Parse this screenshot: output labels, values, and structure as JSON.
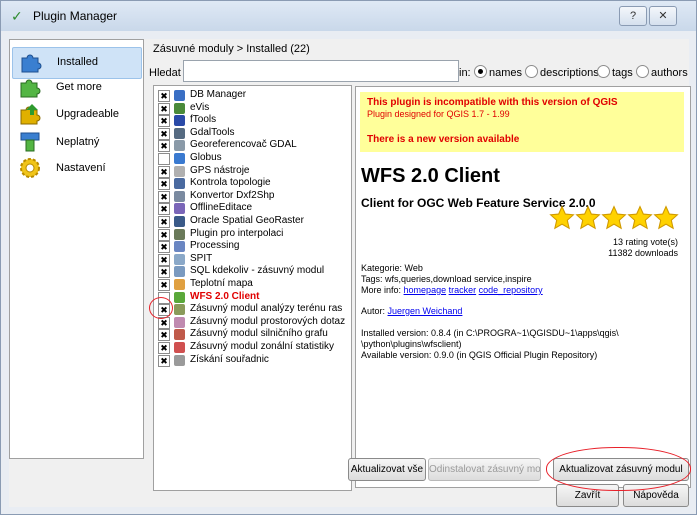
{
  "window": {
    "title": "Plugin Manager",
    "help_btn": "?",
    "close_btn": "✕"
  },
  "nav": {
    "items": [
      {
        "label": "Installed",
        "icon": "plugin-puzzle-icon",
        "selected": true
      },
      {
        "label": "Get more",
        "icon": "plugin-puzzle-icon"
      },
      {
        "label": "Upgradeable",
        "icon": "plugin-upgrade-icon"
      },
      {
        "label": "Neplatný",
        "icon": "plugin-invalid-icon"
      },
      {
        "label": "Nastavení",
        "icon": "gear-icon"
      }
    ]
  },
  "list_header": "Zásuvné moduly > Installed (22)",
  "search": {
    "label": "Hledat",
    "value": "",
    "in_label": "in:"
  },
  "filters": [
    {
      "label": "names",
      "selected": true
    },
    {
      "label": "descriptions",
      "selected": false
    },
    {
      "label": "tags",
      "selected": false
    },
    {
      "label": "authors",
      "selected": false
    }
  ],
  "plugins": [
    {
      "name": "DB Manager",
      "checked": true,
      "icon_color": "#3a6fc4"
    },
    {
      "name": "eVis",
      "checked": true,
      "icon_color": "#4a8a3a"
    },
    {
      "name": "fTools",
      "checked": true,
      "icon_color": "#2a4aa8"
    },
    {
      "name": "GdalTools",
      "checked": true,
      "icon_color": "#566b82"
    },
    {
      "name": "Georeferencovač GDAL",
      "checked": true,
      "icon_color": "#8a9aa8"
    },
    {
      "name": "Globus",
      "checked": false,
      "icon_color": "#3a7ad0"
    },
    {
      "name": "GPS nástroje",
      "checked": true,
      "icon_color": "#b0b0b0"
    },
    {
      "name": "Kontrola topologie",
      "checked": true,
      "icon_color": "#4a6aa0"
    },
    {
      "name": "Konvertor Dxf2Shp",
      "checked": true,
      "icon_color": "#7a8aa0"
    },
    {
      "name": "OfflineEditace",
      "checked": true,
      "icon_color": "#7a66b8"
    },
    {
      "name": "Oracle Spatial GeoRaster",
      "checked": true,
      "icon_color": "#3a5a88"
    },
    {
      "name": "Plugin pro interpolaci",
      "checked": true,
      "icon_color": "#6a7a5a"
    },
    {
      "name": "Processing",
      "checked": true,
      "icon_color": "#6a86c2"
    },
    {
      "name": "SPIT",
      "checked": true,
      "icon_color": "#8aa8c8"
    },
    {
      "name": "SQL kdekoliv - zásuvný modul",
      "checked": true,
      "icon_color": "#7a9ac0"
    },
    {
      "name": "Teplotní mapa",
      "checked": true,
      "icon_color": "#e0a040"
    },
    {
      "name": "WFS 2.0 Client",
      "checked": false,
      "icon_color": "#5aa83a",
      "incompatible": true
    },
    {
      "name": "Zásuvný modul analýzy terénu ras",
      "checked": true,
      "icon_color": "#8a9a5a"
    },
    {
      "name": "Zásuvný modul prostorových dotaz",
      "checked": true,
      "icon_color": "#c08ab0"
    },
    {
      "name": "Zásuvný modul silničního grafu",
      "checked": true,
      "icon_color": "#c05a4a"
    },
    {
      "name": "Zásuvný modul zonální statistiky",
      "checked": true,
      "icon_color": "#d05050"
    },
    {
      "name": "Získání souřadnic",
      "checked": true,
      "icon_color": "#9a9a9a"
    }
  ],
  "detail": {
    "warn_incompatible": "This plugin is incompatible with this version of QGIS",
    "warn_designed": "Plugin designed for QGIS 1.7 - 1.99",
    "warn_new_version": "There is a new version available",
    "title": "WFS 2.0 Client",
    "description": "Client for OGC Web Feature Service 2.0.0",
    "rating_stars": 5,
    "rating_votes": "13 rating vote(s)",
    "downloads": "11382 downloads",
    "category": "Kategorie: Web",
    "tags": "Tags: wfs,queries,download service,inspire",
    "more_info_label": "More info:",
    "links": [
      "homepage",
      "tracker",
      "code_repository"
    ],
    "author_label": "Autor:",
    "author": "Juergen Weichand",
    "installed_version": "Installed version: 0.8.4 (in C:\\PROGRA~1\\QGISDU~1\\apps\\qgis\\",
    "installed_path": "\\python\\plugins\\wfsclient)",
    "available_version": "Available version: 0.9.0 (in QGIS Official Plugin Repository)"
  },
  "buttons": {
    "upgrade_all": "Aktualizovat vše",
    "uninstall": "Odinstalovat zásuvný modul",
    "upgrade": "Aktualizovat zásuvný modul",
    "close": "Zavřít",
    "help": "Nápověda"
  },
  "colors": {
    "accent": "#cfe3f7",
    "warning_bg": "#ffff9a",
    "warning_text": "#e00000",
    "annotation": "#e8212a"
  }
}
